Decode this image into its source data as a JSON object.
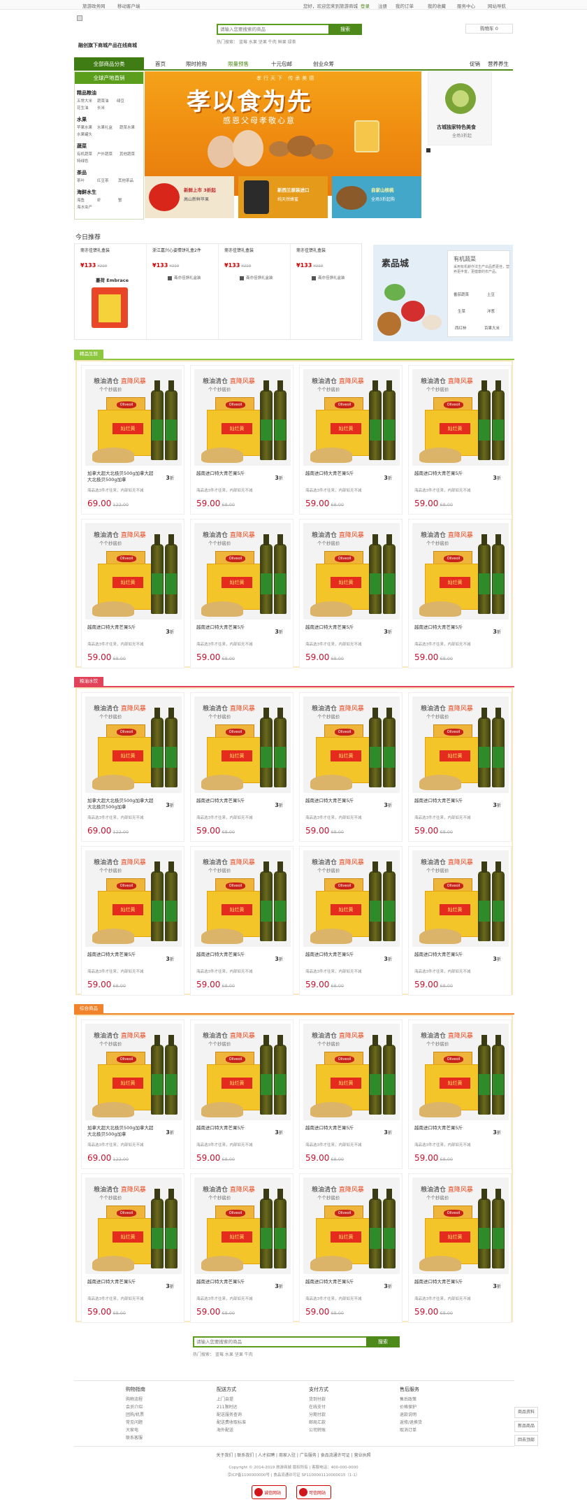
{
  "top_bar": {
    "left": [
      "旅游政务网",
      "移动客户端"
    ],
    "welcome": "您好，欢迎您来到旅游商城",
    "login": "登录",
    "register": "注册",
    "links": [
      "我的订单",
      "我的收藏",
      "服务中心",
      "网站导航"
    ]
  },
  "header": {
    "logo_text": "融创旗下商城产品在线商城",
    "search_placeholder": "请输入您要搜索的商品",
    "search_button": "搜索",
    "hot_label": "热门搜索：",
    "hot_words": [
      "蓝莓",
      "水果",
      "坚果",
      "牛肉",
      "鲜果",
      "绿茶"
    ],
    "cart": "购物车 0"
  },
  "nav": {
    "all": "全部商品分类",
    "items": [
      "首页",
      "限时抢购",
      "限量预售",
      "十元包邮",
      "创业众筹"
    ],
    "right": [
      "促销",
      "营养养生"
    ]
  },
  "sidebar": {
    "head": "全球产地直销",
    "groups": [
      {
        "name": "精品粮油",
        "subs": [
          "五常大米",
          "蔬菜油",
          "绿豆",
          "花生油",
          "长米"
        ]
      },
      {
        "name": "水果",
        "subs": [
          "苹果水果",
          "水果礼盒",
          "蔬菜水果",
          "水果罐头"
        ]
      },
      {
        "name": "蔬菜",
        "subs": [
          "有机蔬菜",
          "户外蔬菜",
          "其他蔬菜",
          "特绿色"
        ]
      },
      {
        "name": "茶品",
        "subs": [
          "茶叶",
          "红豆茶",
          "其他茶品"
        ]
      },
      {
        "name": "海鲜水生",
        "subs": [
          "海鱼",
          "虾",
          "蟹",
          "海水虫产"
        ]
      }
    ]
  },
  "banner": {
    "top_text": "孝行天下 传承美德",
    "title": "孝以食为先",
    "subtitle": "感恩父母孝敬心意",
    "promos": [
      {
        "title": "新鲜上市 3折起",
        "sub": "高山新鲜苹果"
      },
      {
        "title": "新西兰原装进口",
        "sub": "纯天然蜂蜜"
      },
      {
        "title": "自家山核桃",
        "sub": "全场3折起购"
      }
    ],
    "side_title": "古城独家特色美食",
    "side_sub": "全场3折起"
  },
  "recommend": {
    "title": "今日推荐",
    "items": [
      {
        "name": "斋亦佳馈礼盒装",
        "price": "¥133",
        "old": "¥219",
        "extra": "蔓荷 Embrace"
      },
      {
        "name": "浙江嘉兴心姿情饼礼盒2件",
        "price": "¥133",
        "old": "¥219",
        "cart": "斋亦佳馈礼盒装"
      },
      {
        "name": "斋亦佳馈礼盒装",
        "price": "¥133",
        "old": "¥219",
        "cart": "斋亦佳馈礼盒装"
      },
      {
        "name": "斋亦佳馈礼盒装",
        "price": "¥133",
        "old": "¥219",
        "cart": "斋亦佳馈礼盒装"
      }
    ],
    "veg": {
      "logo": "素品城",
      "title": "有机蔬菜",
      "desc": "采用有机耕作法生产出品质更佳，营养更丰富，更健康的农产品。",
      "links": [
        "番茄蔬菜",
        "土豆",
        "生菜",
        "洋葱",
        "西红柿",
        "百果大米"
      ]
    }
  },
  "floors": [
    {
      "tag": "精品生鲜",
      "color": "#8dc63f"
    },
    {
      "tag": "粮油水饮",
      "color": "#e2435a"
    },
    {
      "tag": "综合商品",
      "color": "#f1832a"
    }
  ],
  "product": {
    "head_a": "粮油清仓",
    "head_b": "直降风暴",
    "sub": "个个抄底价",
    "bag_text": "灿烂黄",
    "logo_text": "Oliveoil",
    "name_long": "加拿大超大北极贝500g加拿大超大北极贝500g加拿",
    "name_short": "越南进口特大青芒果5斤",
    "disc": "3",
    "disc_unit": "折",
    "tip": "海品选3件才往来，内部如无不减",
    "price_a": "69.00",
    "old_a": "122.00",
    "price_b": "59.00",
    "old_b": "68.00"
  },
  "bottom": {
    "search_placeholder": "请输入您要搜索的商品",
    "search_button": "搜索",
    "hot_label": "热门搜索：",
    "hot_words": [
      "蓝莓",
      "水果",
      "坚果",
      "牛肉"
    ]
  },
  "footer": {
    "cols": [
      {
        "title": "购物指南",
        "links": [
          "购物流程",
          "会员介绍",
          "团购/机票",
          "常见问题",
          "大家电",
          "联系客服"
        ]
      },
      {
        "title": "配送方式",
        "links": [
          "上门自提",
          "211限时达",
          "配送服务查询",
          "配送费收取标准",
          "海外配送"
        ]
      },
      {
        "title": "支付方式",
        "links": [
          "货到付款",
          "在线支付",
          "分期付款",
          "邮局汇款",
          "公司转账"
        ]
      },
      {
        "title": "售后服务",
        "links": [
          "售后政策",
          "价格保护",
          "退款说明",
          "返修/退换货",
          "取消订单"
        ]
      }
    ],
    "float": [
      "商品资料",
      "新品商品",
      "回去顶部"
    ],
    "links": [
      "关于我们",
      "联系我们",
      "人才招聘",
      "商家入驻",
      "广告服务",
      "食品流通许可证",
      "营业执照"
    ],
    "copy1": "Copyright © 2014-2019 旅游商城 版权所有 | 客服电话：400-000-0000",
    "copy2": "京ICP备1100000000号 | 食品流通许可证 SP1100001110000015（1-1）",
    "badges": [
      "诚信网站",
      "可信网站"
    ]
  }
}
